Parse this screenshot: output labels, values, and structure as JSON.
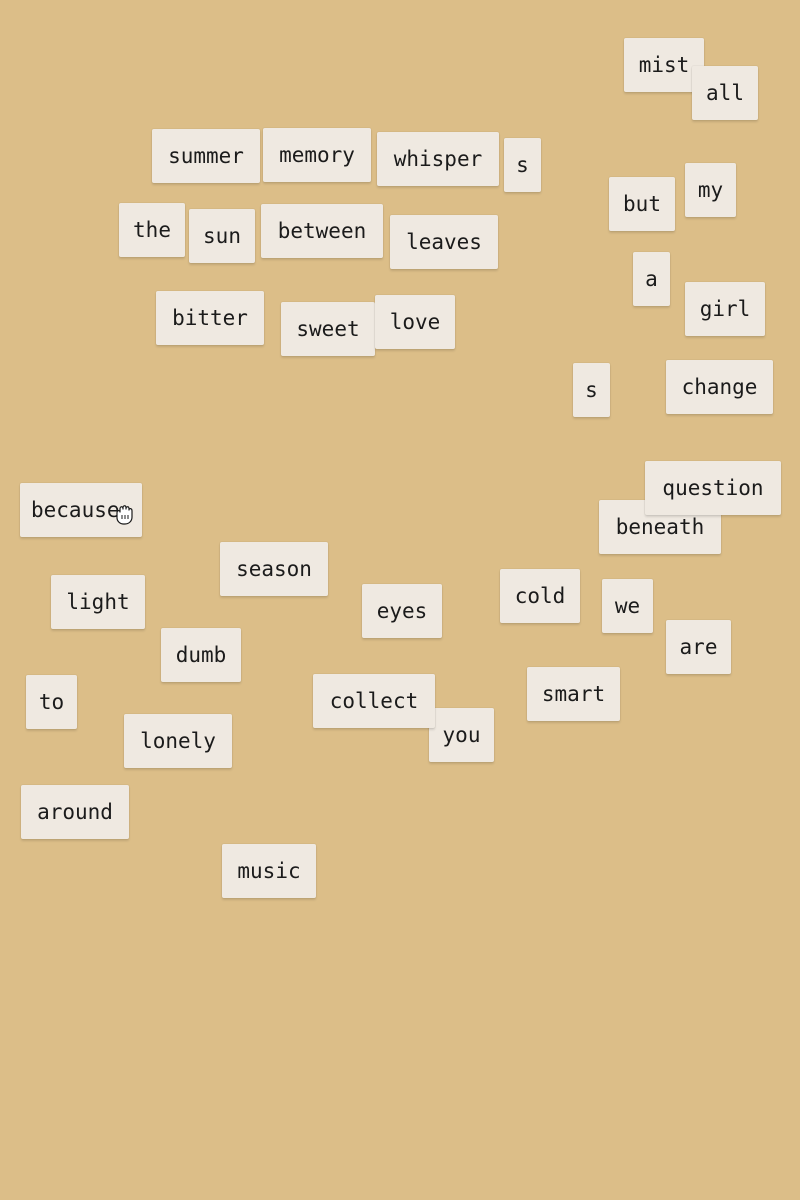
{
  "board": {
    "background": "#dcbe88",
    "tile_color": "#efe9e1",
    "text_color": "#1b1b1b",
    "cursor": "grab-hand-icon"
  },
  "tiles": [
    "mist",
    "all",
    "summer",
    "memory",
    "whisper",
    "s",
    "but",
    "my",
    "the",
    "sun",
    "between",
    "leaves",
    "a",
    "bitter",
    "sweet",
    "love",
    "girl",
    "s",
    "change",
    "question",
    "because",
    "beneath",
    "season",
    "light",
    "eyes",
    "cold",
    "we",
    "dumb",
    "are",
    "smart",
    "to",
    "collect",
    "you",
    "lonely",
    "around",
    "music"
  ]
}
